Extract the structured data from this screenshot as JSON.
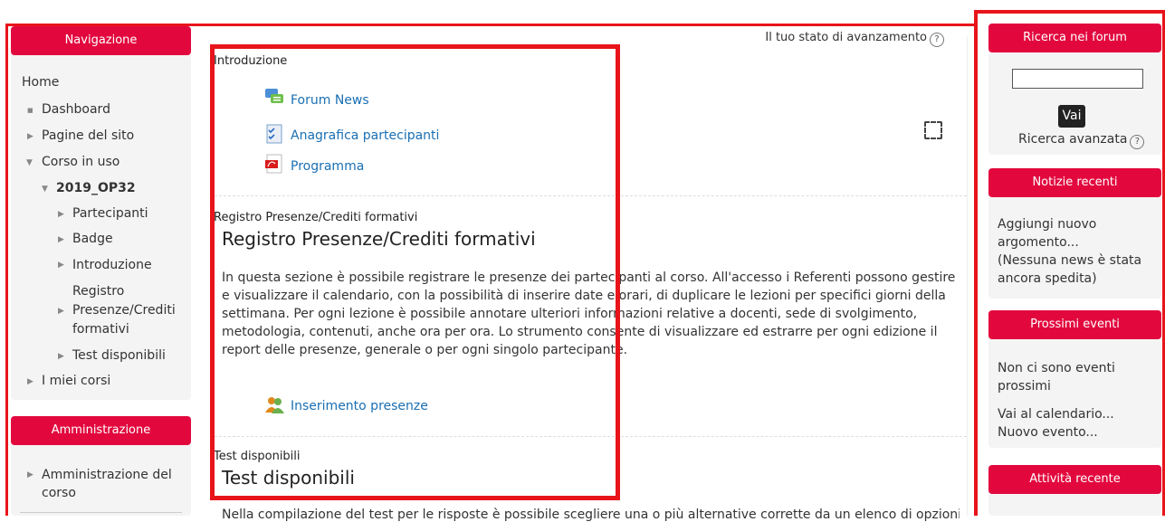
{
  "nav": {
    "header": "Navigazione",
    "items": [
      "Home",
      "Dashboard",
      "Pagine del sito",
      "Corso in uso",
      "2019_OP32",
      "Partecipanti",
      "Badge",
      "Introduzione",
      "Registro",
      "Presenze/Crediti",
      "formativi",
      "Test disponibili",
      "I miei corsi"
    ]
  },
  "admin": {
    "header": "Amministrazione",
    "item_line1": "Amministrazione del",
    "item_line2": "corso"
  },
  "progress": {
    "label": "Il tuo stato di avanzamento",
    "help": "?"
  },
  "intro": {
    "label": "Introduzione",
    "activities": [
      "Forum News",
      "Anagrafica partecipanti",
      "Programma"
    ]
  },
  "registro": {
    "label": "Registro Presenze/Crediti formativi",
    "title": "Registro Presenze/Crediti formativi",
    "body": "In questa sezione è possibile registrare le presenze dei partecipanti al corso. All'accesso i Referenti possono gestire e visualizzare il calendario, con la possibilità di inserire date e orari, di duplicare le lezioni per specifici giorni della settimana. Per ogni lezione è possibile annotare ulteriori informazioni relative a docenti, sede di svolgimento, metodologia, contenuti, anche ora per ora. Lo strumento consente di visualizzare ed estrarre per ogni edizione il report delle presenze, generale o per ogni singolo partecipante.",
    "activity": "Inserimento presenze"
  },
  "test": {
    "label": "Test disponibili",
    "title": "Test disponibili",
    "body_partial": "Nella compilazione del test per le risposte è possibile scegliere una o più alternative corrette da un elenco di opzioni"
  },
  "forum": {
    "header": "Ricerca nei forum",
    "search_value": "",
    "button": "Vai",
    "advanced": "Ricerca avanzata"
  },
  "news": {
    "header": "Notizie recenti",
    "line1": "Aggiungi nuovo",
    "line2": "argomento...",
    "line3": "(Nessuna news è stata",
    "line4": "ancora spedita)"
  },
  "events": {
    "header": "Prossimi eventi",
    "line1": "Non ci sono eventi",
    "line2": "prossimi",
    "link1": "Vai al calendario...",
    "link2": "Nuovo evento..."
  },
  "recent": {
    "header": "Attività recente"
  },
  "colors": {
    "accent": "#e2083e",
    "annotation": "#e8141b",
    "link": "#1a6fb3"
  }
}
